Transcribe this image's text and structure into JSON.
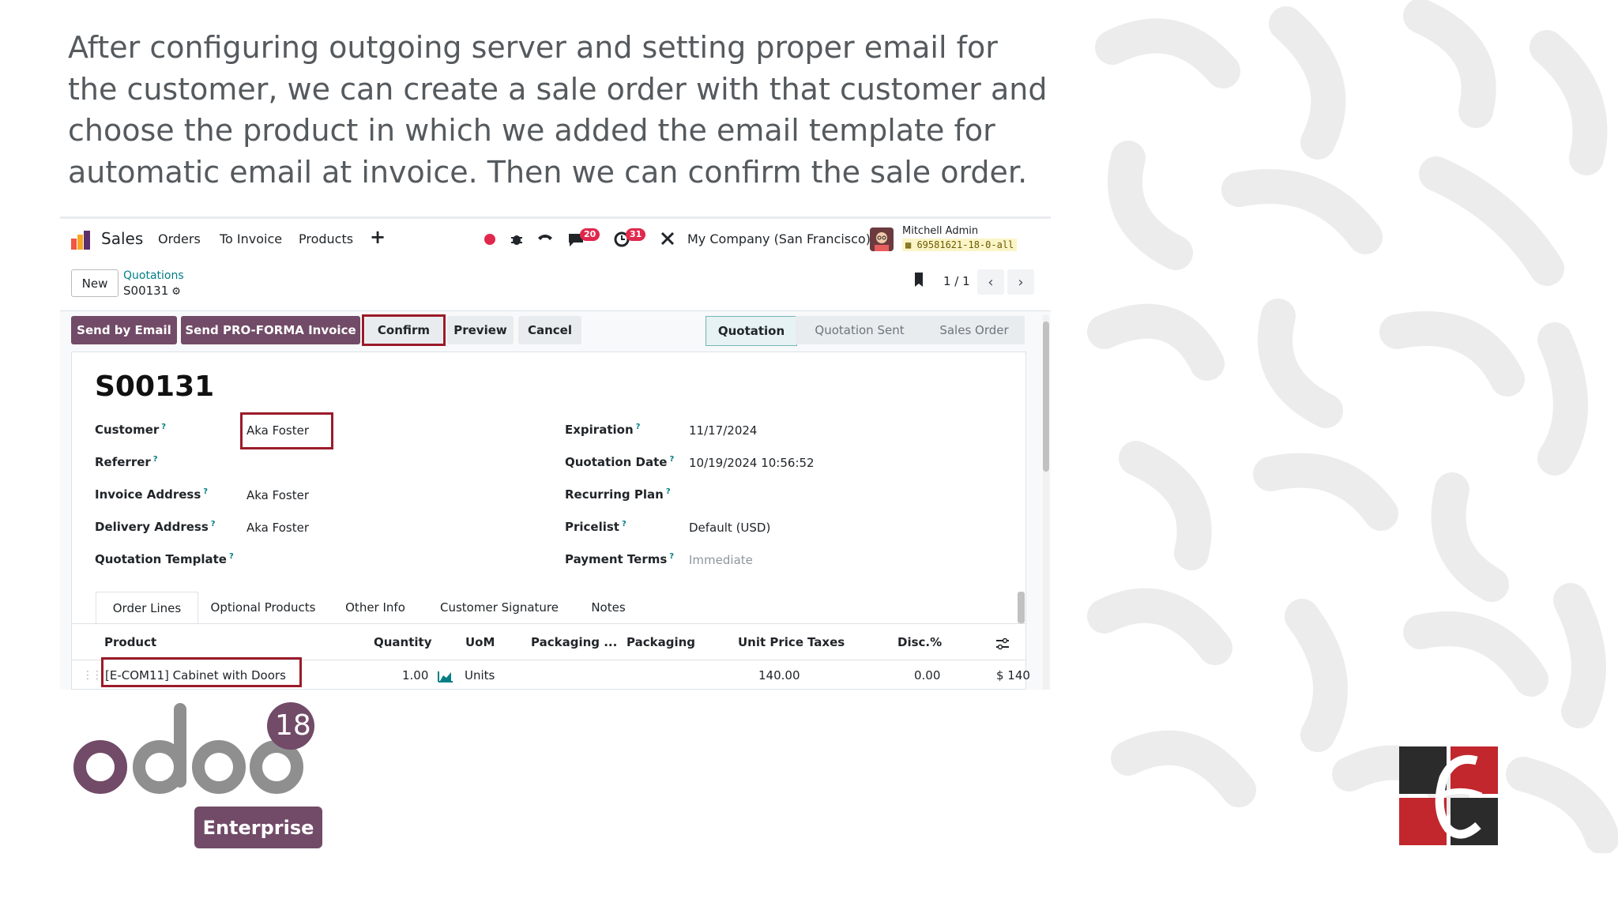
{
  "caption": "After configuring outgoing server and setting proper email for the customer, we can create a sale order with that customer and choose the product in which we added the email template for automatic email at invoice. Then we can confirm the sale order.",
  "navbar": {
    "app_name": "Sales",
    "menu": [
      "Orders",
      "To Invoice",
      "Products"
    ],
    "plus_icon": "+",
    "chat_badge": "20",
    "activity_badge": "31",
    "company": "My Company (San Francisco)",
    "user_name": "Mitchell Admin",
    "db_name": "69581621-18-0-all"
  },
  "control_panel": {
    "new_button": "New",
    "breadcrumb_parent": "Quotations",
    "breadcrumb_current": "S00131",
    "pager": "1 / 1"
  },
  "actions": {
    "send_email": "Send by Email",
    "send_proforma": "Send PRO-FORMA Invoice",
    "confirm": "Confirm",
    "preview": "Preview",
    "cancel": "Cancel"
  },
  "statusbar": [
    "Quotation",
    "Quotation Sent",
    "Sales Order"
  ],
  "form": {
    "title": "S00131",
    "customer_label": "Customer",
    "customer": "Aka Foster",
    "referrer_label": "Referrer",
    "invoice_address_label": "Invoice Address",
    "invoice_address": "Aka Foster",
    "delivery_address_label": "Delivery Address",
    "delivery_address": "Aka Foster",
    "quotation_template_label": "Quotation Template",
    "expiration_label": "Expiration",
    "expiration": "11/17/2024",
    "quotation_date_label": "Quotation Date",
    "quotation_date": "10/19/2024 10:56:52",
    "recurring_plan_label": "Recurring Plan",
    "pricelist_label": "Pricelist",
    "pricelist": "Default (USD)",
    "payment_terms_label": "Payment Terms",
    "payment_terms": "Immediate",
    "help_mark": "?"
  },
  "tabs": [
    "Order Lines",
    "Optional Products",
    "Other Info",
    "Customer Signature",
    "Notes"
  ],
  "table": {
    "columns": [
      "Product",
      "Quantity",
      "UoM",
      "Packaging ...",
      "Packaging",
      "Unit Price",
      "Taxes",
      "Disc.%"
    ],
    "row": {
      "product": "[E-COM11] Cabinet with Doors",
      "quantity": "1.00",
      "uom": "Units",
      "unit_price": "140.00",
      "discount": "0.00",
      "subtotal": "$ 140"
    }
  },
  "branding": {
    "odoo_version": "18",
    "edition": "Enterprise",
    "odoo_color": "#714b67"
  }
}
